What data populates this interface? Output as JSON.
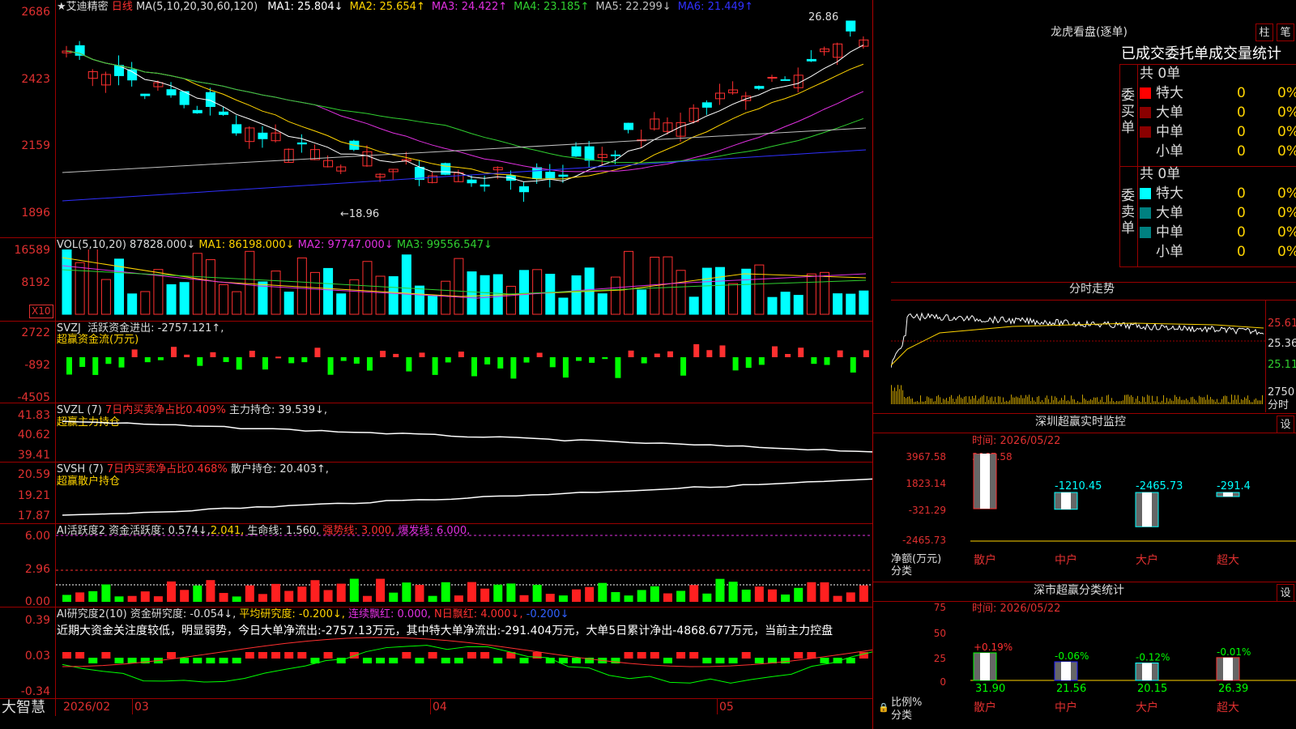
{
  "stock": {
    "star": "★",
    "name": "艾迪精密",
    "period": "日线"
  },
  "main": {
    "ma_header": "MA(5,10,20,30,60,120)",
    "ma": [
      {
        "label": "MA1:",
        "value": "25.804",
        "arrow": "↓",
        "color": "#ffffff"
      },
      {
        "label": "MA2:",
        "value": "25.654",
        "arrow": "↑",
        "color": "#ffd400"
      },
      {
        "label": "MA3:",
        "value": "24.422",
        "arrow": "↑",
        "color": "#e030e0"
      },
      {
        "label": "MA4:",
        "value": "23.185",
        "arrow": "↑",
        "color": "#30d030"
      },
      {
        "label": "MA5:",
        "value": "22.299",
        "arrow": "↓",
        "color": "#c0c0c0"
      },
      {
        "label": "MA6:",
        "value": "21.449",
        "arrow": "↑",
        "color": "#3030ff"
      }
    ],
    "axis": [
      "2686",
      "2423",
      "2159",
      "1896"
    ],
    "high_label": "26.86",
    "low_label": "18.96"
  },
  "vol": {
    "header": "VOL(5,10,20)",
    "value": "87828.000↓",
    "ma1": "MA1: 86198.000↓",
    "ma2": "MA2: 97747.000↓",
    "ma3": "MA3: 99556.547↓",
    "axis": [
      "16589",
      "8192"
    ],
    "unit": "X10"
  },
  "svzj": {
    "title": "SVZJ",
    "line1": "活跃资金进出: -2757.121↑,",
    "line2": "超赢资金流(万元)",
    "axis": [
      "2722",
      "-892",
      "-4505"
    ]
  },
  "svzl": {
    "title": "SVZL (7)",
    "l1": "7日内买卖净占比0.409%",
    "l2": "主力持仓: 39.539↓,",
    "sub": "超赢主力持仓",
    "axis": [
      "41.83",
      "40.62",
      "39.41"
    ]
  },
  "svsh": {
    "title": "SVSH (7)",
    "l1": "7日内买卖净占比0.468%",
    "l2": "散户持仓: 20.403↑,",
    "sub": "超赢散户持仓",
    "axis": [
      "20.59",
      "19.21",
      "17.87"
    ]
  },
  "ai1": {
    "title": "AI活跃度2",
    "a": "资金活跃度: 0.574↓,",
    "b": "2.041,",
    "c": "生命线: 1.560,",
    "d": "强势线: 3.000,",
    "e": "爆发线: 6.000,",
    "axis": [
      "6.00",
      "2.96",
      "0.00"
    ]
  },
  "ai2": {
    "title": "AI研究度2(10)",
    "a": "资金研究度: -0.054↓,",
    "b": "平均研究度: -0.200↓,",
    "c": "连续飘红: 0.000,",
    "d": "N日飘红: 4.000↓,",
    "e": "-0.200↓",
    "comment": "近期大资金关注度较低，明显弱势，今日大单净流出:-2757.13万元，其中特大单净流出:-291.404万元，大单5日累计净出-4868.677万元，当前主力控盘",
    "axis": [
      "0.39",
      "0.03",
      "-0.34"
    ]
  },
  "bottom": {
    "brand": "大智慧",
    "dates": [
      "2026/02",
      "03",
      "04",
      "05"
    ]
  },
  "lhb": {
    "title": "龙虎看盘(逐单)",
    "btn1": "柱",
    "btn2": "笔",
    "tabs": "已成交委托单成交量统计",
    "buy_label": "委买单",
    "sell_label": "委卖单",
    "buy_total": "共 0单",
    "sell_total": "共 0单",
    "rows": [
      {
        "name": "特大",
        "v": "0",
        "p": "0%"
      },
      {
        "name": "大单",
        "v": "0",
        "p": "0%"
      },
      {
        "name": "中单",
        "v": "0",
        "p": "0%"
      },
      {
        "name": "小单",
        "v": "0",
        "p": "0%"
      }
    ],
    "buy_colors": [
      "#ff0000",
      "#8a0000",
      "#8a0000"
    ],
    "sell_colors": [
      "#00ffff",
      "#008080",
      "#008080"
    ]
  },
  "fenshi": {
    "title": "分时走势",
    "axis": [
      "25.61",
      "25.36",
      "25.11"
    ],
    "vol_axis": [
      "2750",
      "分时"
    ]
  },
  "monitor": {
    "title": "深圳超赢实时监控",
    "btn": "设",
    "time": "时间: 2026/05/22",
    "axis": [
      "3967.58",
      "1823.14",
      "-321.29",
      "-2465.73"
    ],
    "top": "3967.58",
    "unit1": "净额(万元)",
    "unit2": "分类",
    "bars": [
      {
        "label": "散户",
        "value": "3967.58"
      },
      {
        "label": "中户",
        "value": "-1210.45"
      },
      {
        "label": "大户",
        "value": "-2465.73"
      },
      {
        "label": "超大",
        "value": "-291.4"
      }
    ]
  },
  "classify": {
    "title": "深市超赢分类统计",
    "btn": "设",
    "time": "时间: 2026/05/22",
    "axis": [
      "75",
      "50",
      "25",
      "0"
    ],
    "unit1": "比例%",
    "unit2": "分类",
    "bars": [
      {
        "label": "散户",
        "pct": "31.90",
        "chg": "+0.19%"
      },
      {
        "label": "中户",
        "pct": "21.56",
        "chg": "-0.06%"
      },
      {
        "label": "大户",
        "pct": "20.15",
        "chg": "-0.12%"
      },
      {
        "label": "超大",
        "pct": "26.39",
        "chg": "-0.01%"
      }
    ]
  }
}
